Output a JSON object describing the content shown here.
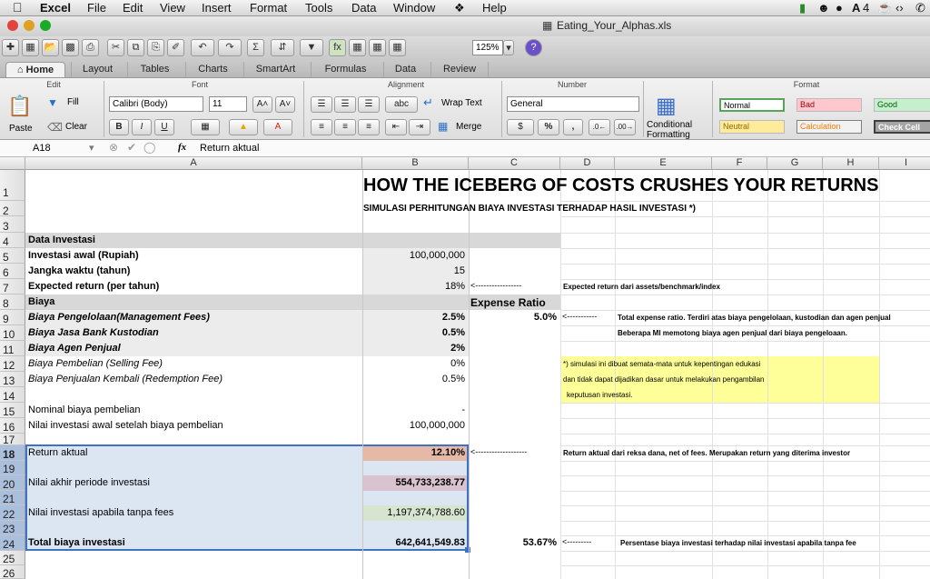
{
  "menubar": {
    "app": "Excel",
    "items": [
      "File",
      "Edit",
      "View",
      "Insert",
      "Format",
      "Tools",
      "Data",
      "Window",
      "Help"
    ],
    "status_num": "4"
  },
  "window": {
    "title": "Eating_Your_Alphas.xls"
  },
  "toolbar": {
    "zoom": "125%"
  },
  "ribbon": {
    "tabs": [
      "Home",
      "Layout",
      "Tables",
      "Charts",
      "SmartArt",
      "Formulas",
      "Data",
      "Review"
    ],
    "groups": {
      "edit": "Edit",
      "font": "Font",
      "alignment": "Alignment",
      "number": "Number",
      "format": "Format"
    },
    "fill": "Fill",
    "clear": "Clear",
    "paste": "Paste",
    "font_name": "Calibri (Body)",
    "font_size": "11",
    "wrap_text": "Wrap Text",
    "merge": "Merge",
    "number_format": "General",
    "conditional": "Conditional",
    "formatting": "Formatting",
    "styles": {
      "normal": "Normal",
      "bad": "Bad",
      "good": "Good",
      "neutral": "Neutral",
      "calculation": "Calculation",
      "check_cell": "Check Cell"
    }
  },
  "formula_bar": {
    "cell_ref": "A18",
    "fx": "fx",
    "content": "Return aktual"
  },
  "columns": [
    "A",
    "B",
    "C",
    "D",
    "E",
    "F",
    "G",
    "H",
    "I"
  ],
  "rows": [
    "1",
    "2",
    "3",
    "4",
    "5",
    "6",
    "7",
    "8",
    "9",
    "10",
    "11",
    "12",
    "13",
    "14",
    "15",
    "16",
    "17",
    "18",
    "19",
    "20",
    "21",
    "22",
    "23",
    "24",
    "25",
    "26"
  ],
  "sheet": {
    "title": "HOW THE ICEBERG OF COSTS CRUSHES YOUR RETURNS",
    "subtitle": "SIMULASI PERHITUNGAN BIAYA INVESTASI TERHADAP HASIL INVESTASI *)",
    "data_investasi": "Data Investasi",
    "inv_awal_label": "Investasi awal (Rupiah)",
    "inv_awal": "100,000,000",
    "jangka_label": "Jangka waktu (tahun)",
    "jangka": "15",
    "exp_return_label": "Expected return (per tahun)",
    "exp_return": "18%",
    "arrow7": "<-----------------",
    "note7": "Expected return dari assets/benchmark/index",
    "biaya": "Biaya",
    "expense_ratio": "Expense Ratio",
    "mgmt_label": "Biaya Pengelolaan(Management Fees)",
    "mgmt": "2.5%",
    "expense_total": "5.0%",
    "arrow9": "<-----------",
    "note9": "Total expense ratio. Terdiri atas biaya pengelolaan, kustodian dan agen penjual",
    "kustodian_label": "Biaya Jasa Bank Kustodian",
    "kustodian": "0.5%",
    "note10": "Beberapa MI memotong biaya agen penjual dari biaya pengeloaan.",
    "agen_label": "Biaya Agen Penjual",
    "agen": "2%",
    "pembelian_label": "Biaya Pembelian (Selling Fee)",
    "pembelian": "0%",
    "penjualan_label": "Biaya Penjualan Kembali (Redemption Fee)",
    "penjualan": "0.5%",
    "disclaimer1": "*) simulasi ini dibuat semata-mata untuk kepentingan edukasi",
    "disclaimer2": "dan tidak dapat dijadikan dasar untuk melakukan pengambilan",
    "disclaimer3": "keputusan investasi.",
    "nominal_label": "Nominal biaya pembelian",
    "nominal": "-",
    "nilai_awal_label": "Nilai investasi awal setelah biaya pembelian",
    "nilai_awal": "100,000,000",
    "return_label": "Return aktual",
    "return": "12.10%",
    "arrow18": "<-------------------",
    "note18": "Return aktual dari reksa dana, net of fees. Merupakan return yang diterima investor",
    "akhir_label": "Nilai akhir periode investasi",
    "akhir": "554,733,238.77",
    "tanpa_label": "Nilai investasi apabila tanpa fees",
    "tanpa": "1,197,374,788.60",
    "total_label": "Total biaya investasi",
    "total": "642,641,549.83",
    "pct": "53.67%",
    "arrow24": "<---------",
    "note24": "Persentase biaya investasi terhadap nilai investasi apabila tanpa fee"
  }
}
